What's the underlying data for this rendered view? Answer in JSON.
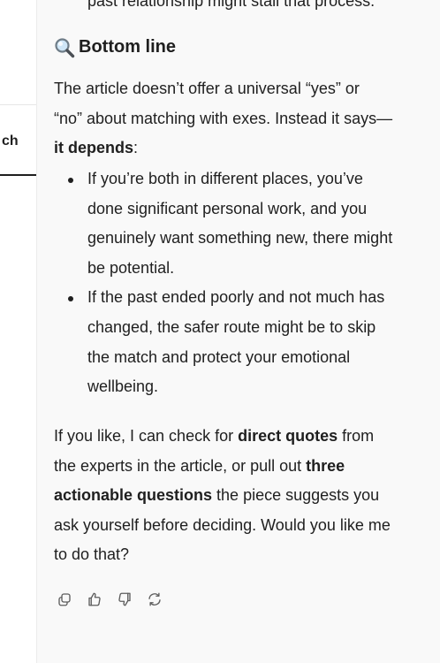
{
  "sidebar": {
    "tab_label": "ch"
  },
  "message": {
    "clipped_line": "past relationship might stall that process.",
    "heading": {
      "icon": "magnifier-icon",
      "text": "Bottom line"
    },
    "para1": {
      "line1": "The article doesn’t offer a universal “yes” or",
      "line2": "“no” about matching with exes. Instead it says—",
      "bold": "it depends",
      "after_bold": ":"
    },
    "bullets": [
      {
        "lines": [
          "If you’re both in different places, you’ve",
          "done significant personal work, and you",
          "genuinely want something new, there might",
          "be potential."
        ]
      },
      {
        "lines": [
          "If the past ended poorly and not much has",
          "changed, the safer route might be to skip",
          "the match and protect your emotional",
          "wellbeing."
        ]
      }
    ],
    "para2": {
      "l1_pre": "If you like, I can check for ",
      "l1_bold": "direct quotes",
      "l1_post": " from",
      "l2_pre": "the experts in the article, or pull out ",
      "l2_bold": "three",
      "l3_bold": "actionable questions",
      "l3_post": " the piece suggests you",
      "l4": "ask yourself before deciding. Would you like me",
      "l5": "to do that?"
    }
  },
  "actions": [
    "copy-icon",
    "thumbs-up-icon",
    "thumbs-down-icon",
    "regenerate-icon"
  ]
}
